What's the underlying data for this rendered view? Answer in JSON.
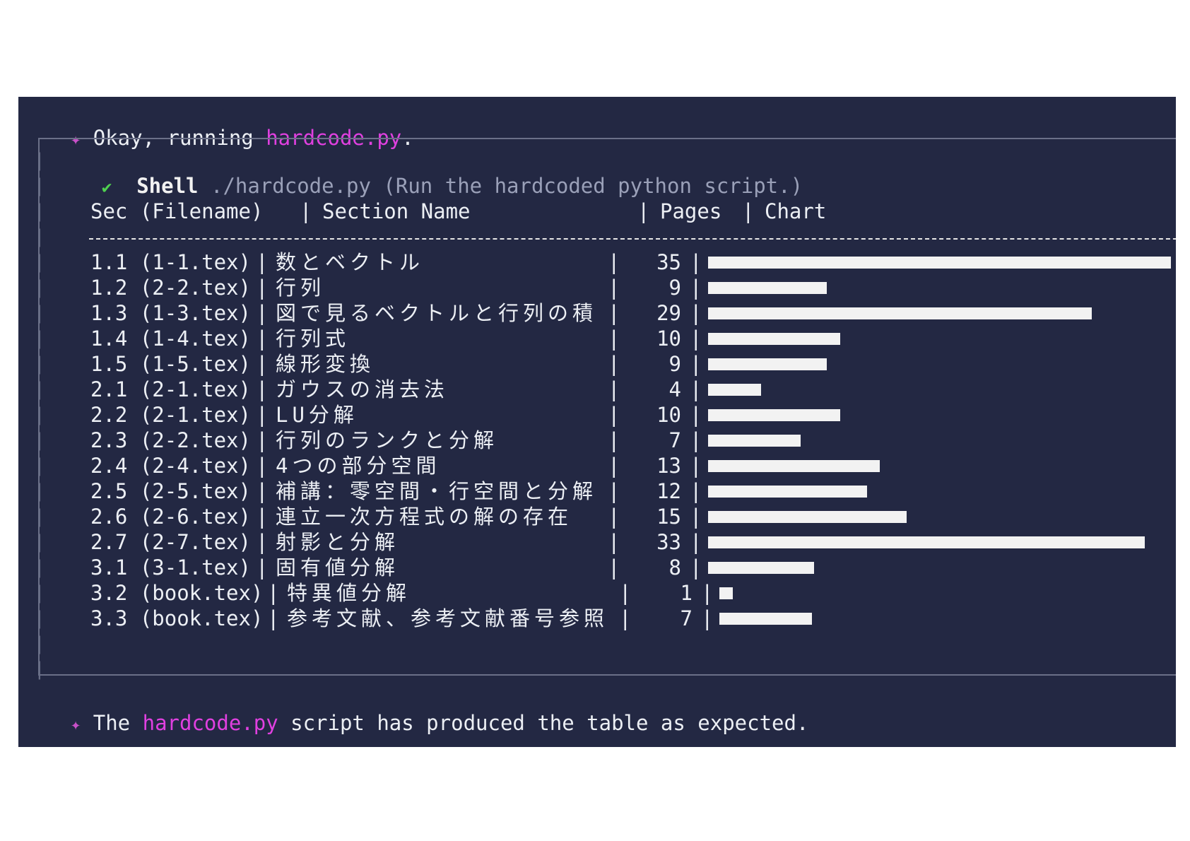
{
  "line1": {
    "prefix": "Okay, running ",
    "file": "hardcode.py",
    "suffix": "."
  },
  "shell": {
    "title": "Shell",
    "command": "./hardcode.py (Run the hardcoded python script.)"
  },
  "table": {
    "headers": {
      "sec": "Sec (Filename)",
      "name": "Section Name",
      "pages": "Pages",
      "chart": "Chart"
    },
    "separator": "|",
    "rows": [
      {
        "sec": "1.1 (1-1.tex)",
        "name": "数とベクトル",
        "pages": "35",
        "value": 35
      },
      {
        "sec": "1.2 (2-2.tex)",
        "name": "行列",
        "pages": "9",
        "value": 9
      },
      {
        "sec": "1.3 (1-3.tex)",
        "name": "図で見るベクトルと行列の積",
        "pages": "29",
        "value": 29
      },
      {
        "sec": "1.4 (1-4.tex)",
        "name": "行列式",
        "pages": "10",
        "value": 10
      },
      {
        "sec": "1.5 (1-5.tex)",
        "name": "線形変換",
        "pages": "9",
        "value": 9
      },
      {
        "sec": "2.1 (2-1.tex)",
        "name": "ガウスの消去法",
        "pages": "4",
        "value": 4
      },
      {
        "sec": "2.2 (2-1.tex)",
        "name": "LU分解",
        "pages": "10",
        "value": 10
      },
      {
        "sec": "2.3 (2-2.tex)",
        "name": "行列のランクと分解",
        "pages": "7",
        "value": 7
      },
      {
        "sec": "2.4 (2-4.tex)",
        "name": "4つの部分空間",
        "pages": "13",
        "value": 13
      },
      {
        "sec": "2.5 (2-5.tex)",
        "name": "補講：零空間・行空間と分解",
        "pages": "12",
        "value": 12
      },
      {
        "sec": "2.6 (2-6.tex)",
        "name": "連立一次方程式の解の存在",
        "pages": "15",
        "value": 15
      },
      {
        "sec": "2.7 (2-7.tex)",
        "name": "射影と分解",
        "pages": "33",
        "value": 33
      },
      {
        "sec": "3.1 (3-1.tex)",
        "name": "固有値分解",
        "pages": "8",
        "value": 8
      },
      {
        "sec": "3.2 (book.tex)",
        "name": "特異値分解",
        "pages": "1",
        "value": 1
      },
      {
        "sec": "3.3 (book.tex)",
        "name": "参考文献、参考文献番号参照",
        "pages": "7",
        "value": 7
      }
    ]
  },
  "line_end": {
    "prefix": "The ",
    "file": "hardcode.py",
    "suffix": " script has produced the table as expected."
  },
  "colors": {
    "background": "#232843",
    "accent": "#e040e0",
    "check": "#4fd14f",
    "bar": "#f2f2f2"
  }
}
